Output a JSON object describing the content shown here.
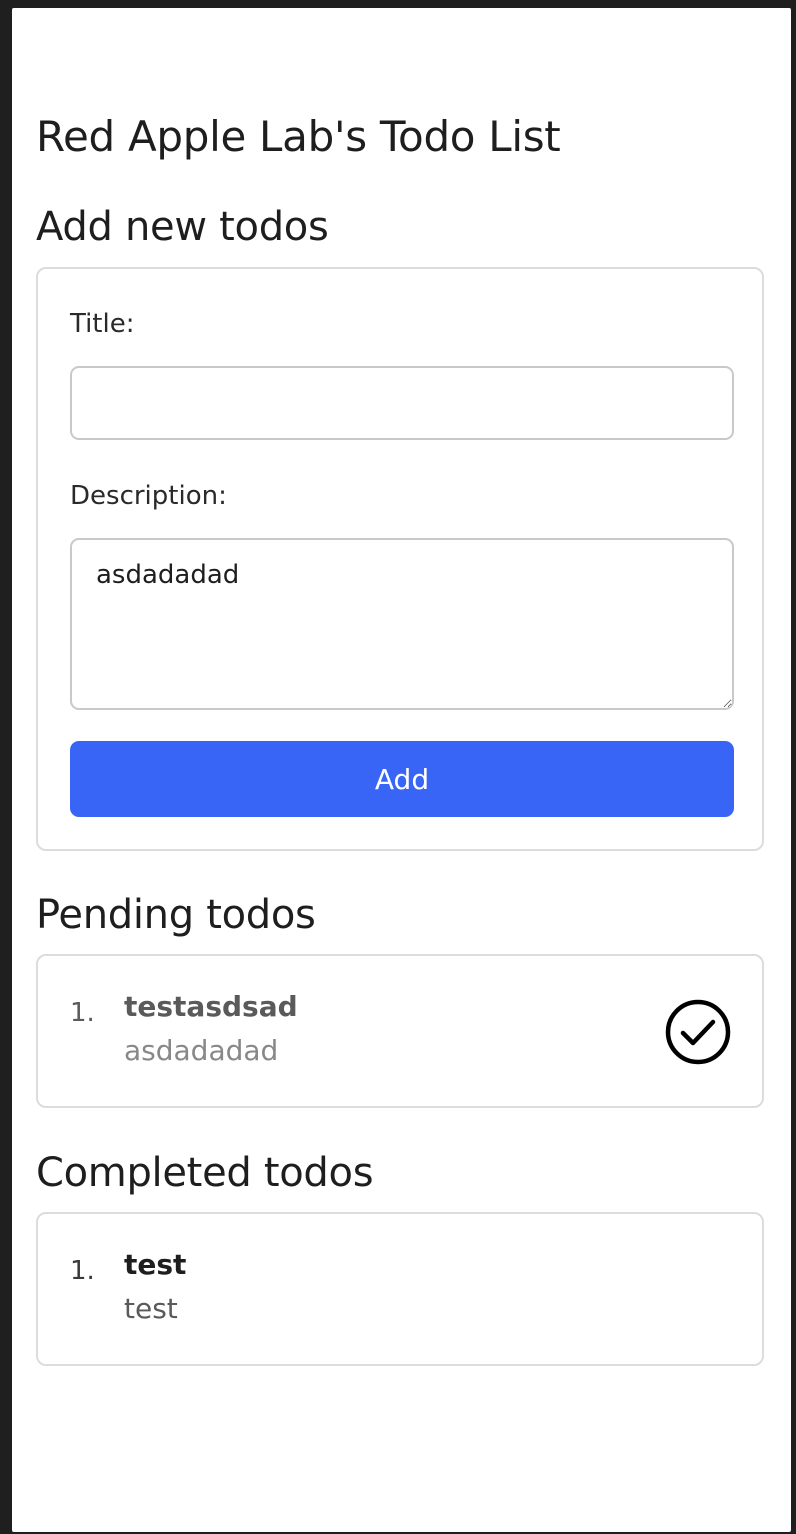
{
  "page": {
    "title": "Red Apple Lab's Todo List"
  },
  "add_section": {
    "heading": "Add new todos",
    "title_label": "Title:",
    "title_value": "",
    "description_label": "Description:",
    "description_value": "asdadadad",
    "add_button_label": "Add",
    "button_color": "#3865f6"
  },
  "pending_section": {
    "heading": "Pending todos",
    "items": [
      {
        "index": "1.",
        "title": "testasdsad",
        "description": "asdadadad",
        "action_icon": "check-circle-icon"
      }
    ]
  },
  "completed_section": {
    "heading": "Completed todos",
    "items": [
      {
        "index": "1.",
        "title": "test",
        "description": "test"
      }
    ]
  }
}
